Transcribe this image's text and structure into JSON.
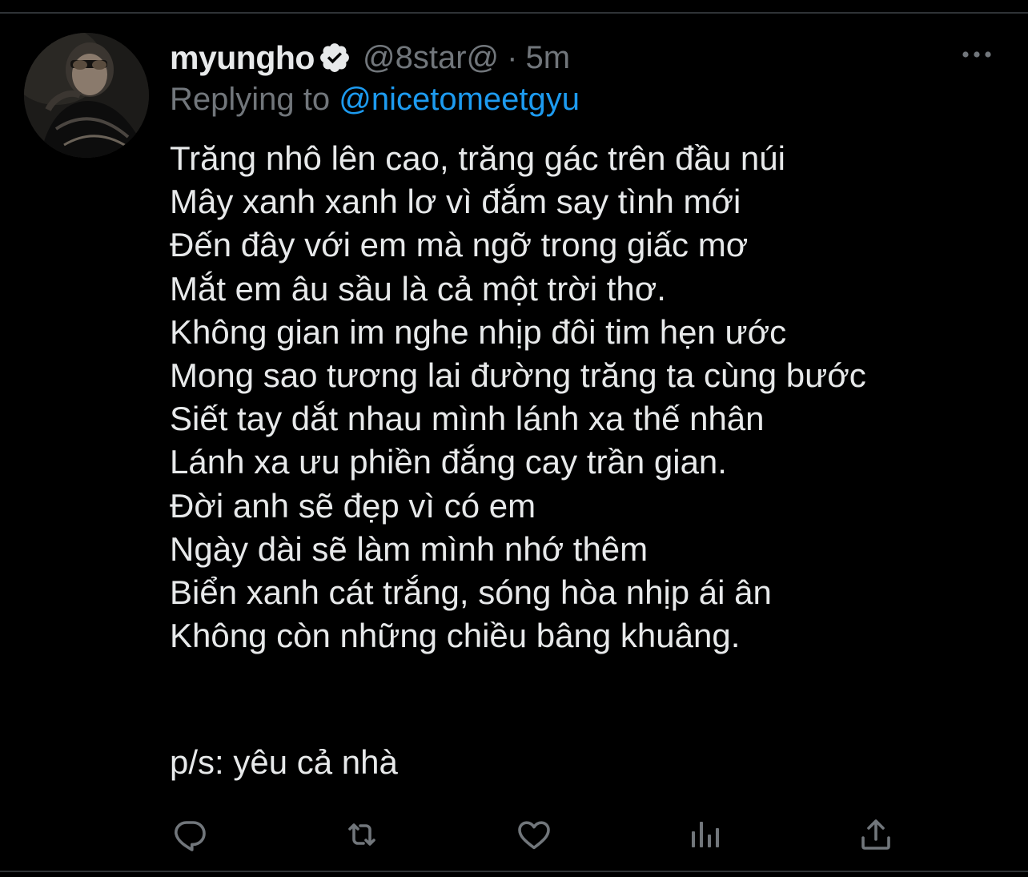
{
  "tweet": {
    "display_name": "myungho",
    "handle": "@8star@",
    "separator": "·",
    "timestamp": "5m",
    "replying_prefix": "Replying to ",
    "replying_to": "@nicetomeetgyu",
    "lines": [
      "Trăng nhô lên cao, trăng gác trên đầu núi",
      "Mây xanh xanh lơ vì đắm say tình mới",
      "Đến đây với em mà ngỡ trong giấc mơ",
      "Mắt em âu sầu là cả một trời thơ.",
      "Không gian im nghe nhịp đôi tim hẹn ước",
      "Mong sao tương lai đường trăng ta cùng bước",
      "Siết tay dắt nhau mình lánh xa thế nhân",
      "Lánh xa ưu phiền đắng cay trần gian.",
      "Đời anh sẽ đẹp vì có em",
      "Ngày dài sẽ làm mình nhớ thêm",
      "Biển xanh cát trắng, sóng hòa nhịp ái ân",
      "Không còn những chiều bâng khuâng."
    ],
    "postscript": "p/s: yêu cả nhà"
  },
  "icons": {
    "verified": "verified-badge-icon",
    "more": "more-options-icon",
    "reply": "reply-icon",
    "retweet": "retweet-icon",
    "like": "heart-icon",
    "analytics": "analytics-icon",
    "share": "share-icon"
  },
  "colors": {
    "background": "#000000",
    "text": "#e7e9ea",
    "muted": "#71767b",
    "accent": "#1d9bf0",
    "divider": "#2f3336"
  }
}
